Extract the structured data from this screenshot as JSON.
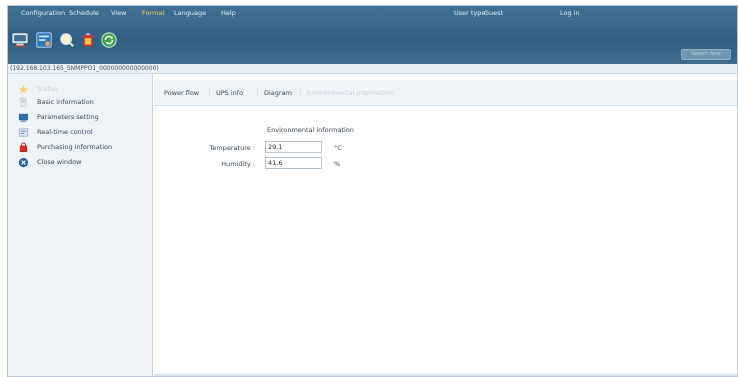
{
  "menu": {
    "items": [
      "Configuration",
      "Schedule",
      "View",
      "Format",
      "Language",
      "Help"
    ],
    "user_type_label": "User type:",
    "user_type_value": "Guest",
    "login_label": "Log in"
  },
  "toolbar": {
    "buttons": [
      "monitor-icon",
      "settings-panel-icon",
      "search-icon",
      "battery-icon",
      "refresh-icon"
    ],
    "ghost_button_label": "Search Now"
  },
  "device_path": "(192.168.103.165_SNMPPO1_000000000000000)",
  "sidebar": {
    "items": [
      {
        "label": "Status",
        "icon": "star-icon",
        "disabled": true
      },
      {
        "label": "Basic information",
        "icon": "document-icon",
        "disabled": false
      },
      {
        "label": "Parameters setting",
        "icon": "monitor-settings-icon",
        "disabled": false
      },
      {
        "label": "Real-time control",
        "icon": "control-panel-icon",
        "disabled": false
      },
      {
        "label": "Purchasing information",
        "icon": "shopping-bag-icon",
        "disabled": false
      },
      {
        "label": "Close window",
        "icon": "close-circle-icon",
        "disabled": false
      }
    ]
  },
  "tabs": [
    {
      "label": "Power flow",
      "active": true
    },
    {
      "label": "UPS info",
      "active": true
    },
    {
      "label": "Diagram",
      "active": true
    },
    {
      "label": "Environmental information",
      "active": false
    }
  ],
  "env": {
    "section_title": "Environmental information",
    "temperature_label": "Temperature :",
    "temperature_value": "29.1",
    "temperature_unit": "°C",
    "humidity_label": "Humidity :",
    "humidity_value": "41.6",
    "humidity_unit": "%"
  },
  "colors": {
    "header": "#3a6a8e",
    "current_menu": "#f2c94c",
    "sidebar_bg": "#eef3f8"
  }
}
